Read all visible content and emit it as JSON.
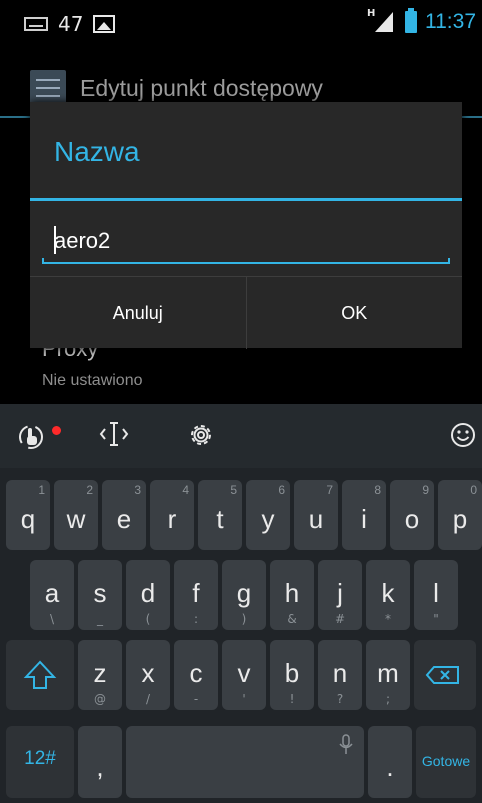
{
  "status": {
    "notification_count": "47",
    "time": "11:37",
    "network_badge": "H",
    "icons": [
      "keyboard-icon",
      "image-icon",
      "signal-icon",
      "battery-icon"
    ]
  },
  "background": {
    "title": "Edytuj punkt dostępowy",
    "proxy_label": "Proxy",
    "proxy_value": "Nie ustawiono"
  },
  "dialog": {
    "title": "Nazwa",
    "input_value": "aero2",
    "cancel_label": "Anuluj",
    "ok_label": "OK"
  },
  "keyboard": {
    "toolbar": [
      "swipe-gesture-icon",
      "cursor-move-icon",
      "settings-gear-icon",
      "emoji-icon"
    ],
    "row1": [
      {
        "k": "q",
        "n": "1"
      },
      {
        "k": "w",
        "n": "2"
      },
      {
        "k": "e",
        "n": "3"
      },
      {
        "k": "r",
        "n": "4"
      },
      {
        "k": "t",
        "n": "5"
      },
      {
        "k": "y",
        "n": "6"
      },
      {
        "k": "u",
        "n": "7"
      },
      {
        "k": "i",
        "n": "8"
      },
      {
        "k": "o",
        "n": "9"
      },
      {
        "k": "p",
        "n": "0"
      }
    ],
    "row2": [
      {
        "k": "a",
        "s": "\\"
      },
      {
        "k": "s",
        "s": "_"
      },
      {
        "k": "d",
        "s": "("
      },
      {
        "k": "f",
        "s": ":"
      },
      {
        "k": "g",
        "s": ")"
      },
      {
        "k": "h",
        "s": "&"
      },
      {
        "k": "j",
        "s": "#"
      },
      {
        "k": "k",
        "s": "*"
      },
      {
        "k": "l",
        "s": "\""
      }
    ],
    "row3": [
      {
        "k": "z",
        "s": "@"
      },
      {
        "k": "x",
        "s": "/"
      },
      {
        "k": "c",
        "s": "-"
      },
      {
        "k": "v",
        "s": "'"
      },
      {
        "k": "b",
        "s": "!"
      },
      {
        "k": "n",
        "s": "?"
      },
      {
        "k": "m",
        "s": ";"
      }
    ],
    "symbols_label": "12#",
    "comma_label": ",",
    "period_label": ".",
    "done_label": "Gotowe",
    "accent_color": "#33b5e5"
  }
}
